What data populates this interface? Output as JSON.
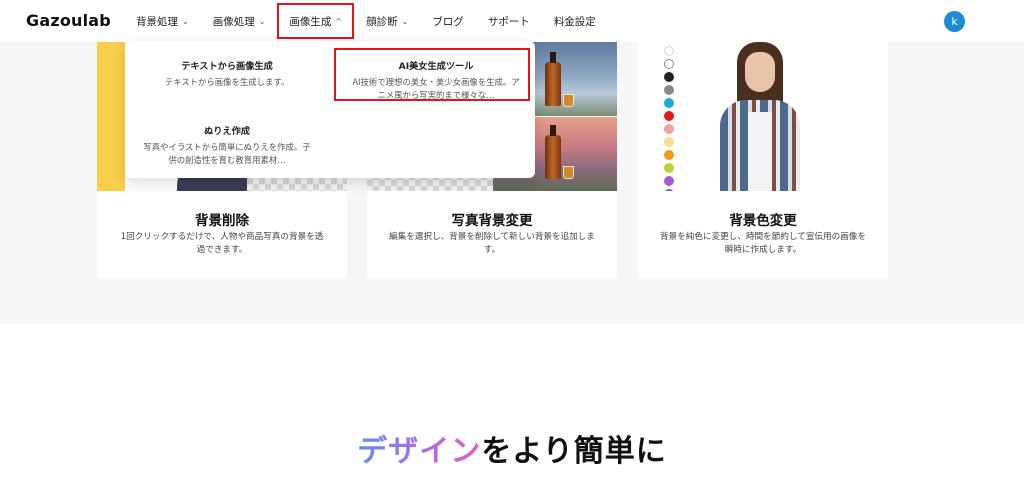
{
  "header": {
    "logo": "Gazoulab",
    "nav": [
      {
        "label": "背景処理",
        "chevron": "⌄"
      },
      {
        "label": "画像処理",
        "chevron": "⌄"
      },
      {
        "label": "画像生成",
        "chevron": "^",
        "active": true
      },
      {
        "label": "顔診断",
        "chevron": "⌄"
      },
      {
        "label": "ブログ"
      },
      {
        "label": "サポート"
      },
      {
        "label": "料金設定"
      }
    ],
    "avatar_initial": "k",
    "avatar_color": "#1d8ad7",
    "highlight_color": "#e3141b"
  },
  "dropdown": {
    "items": [
      {
        "title": "テキストから画像生成",
        "desc": "テキストから画像を生成します。"
      },
      {
        "title": "AI美女生成ツール",
        "desc": "AI技術で理想の美女・美少女画像を生成。アニメ風から写実的まで様々な…",
        "highlighted": true
      },
      {
        "title": "ぬりえ作成",
        "desc": "写真やイラストから簡単にぬりえを作成。子供の創造性を育む教育用素材…"
      }
    ]
  },
  "cards": [
    {
      "title": "背景削除",
      "desc": "1回クリックするだけで、人物や商品写真の背景を透過できます。"
    },
    {
      "title": "写真背景変更",
      "desc": "編集を選択し、背景を削除して新しい背景を追加します。"
    },
    {
      "title": "背景色変更",
      "desc": "背景を純色に変更し、時間を節約して宣伝用の画像を瞬時に作成します。"
    }
  ],
  "swatch_colors": [
    "#ffffff",
    "#ffffff",
    "#222222",
    "#8a8a8a",
    "#1fa7d9",
    "#e41b1b",
    "#f4a1a6",
    "#f2e08c",
    "#f39a1c",
    "#b8d334",
    "#a25bd8",
    "#6b63a8"
  ],
  "bottom_heading": {
    "gradient_part": "デザイン",
    "rest": "をより簡単に"
  }
}
